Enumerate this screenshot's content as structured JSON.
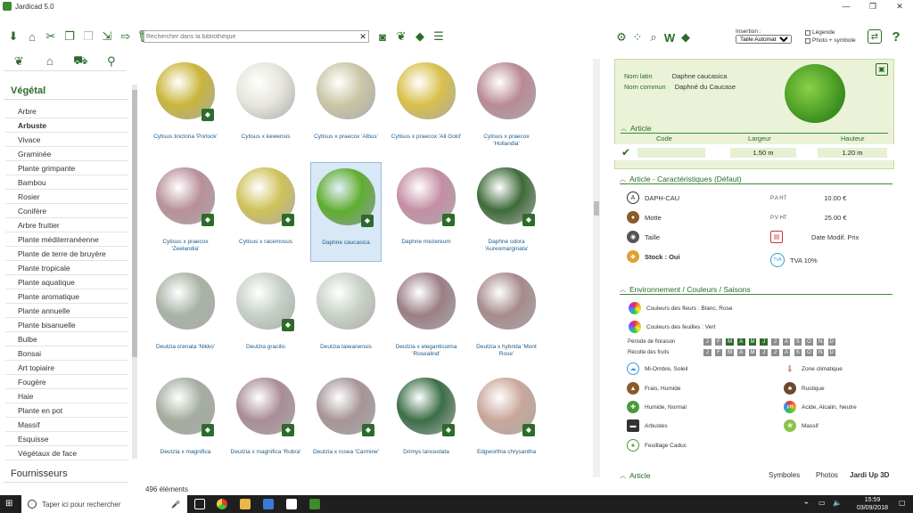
{
  "app": {
    "title": "Jardicad 5.0"
  },
  "window": {
    "min": "—",
    "max": "❐",
    "close": "✕"
  },
  "search": {
    "placeholder": "Rechercher dans la bibliothèque",
    "clear": "✕"
  },
  "sidebar": {
    "section_title": "Végétal",
    "footer_title": "Fournisseurs",
    "items": [
      "Arbre",
      "Arbuste",
      "Vivace",
      "Graminée",
      "Plante grimpante",
      "Bambou",
      "Rosier",
      "Conifère",
      "Arbre fruitier",
      "Plante méditerranéenne",
      "Plante de terre de bruyère",
      "Plante tropicale",
      "Plante aquatique",
      "Plante aromatique",
      "Plante annuelle",
      "Plante bisanuelle",
      "Bulbe",
      "Bonsai",
      "Art topiaire",
      "Fougère",
      "Haie",
      "Plante en pot",
      "Massif",
      "Esquisse",
      "Végétaux de face"
    ],
    "selected_index": 1
  },
  "grid": {
    "items": [
      {
        "label": "Cytisus tinctoria 'Porlock'",
        "color": "#c9b53a",
        "badge": true
      },
      {
        "label": "Cytisus x kewensis",
        "color": "#e6e6dc",
        "badge": false
      },
      {
        "label": "Cytisus x praecox 'Albus'",
        "color": "#c9c6a6",
        "badge": false
      },
      {
        "label": "Cytisus x praecox 'All Gold'",
        "color": "#d8c04a",
        "badge": false
      },
      {
        "label": "Cytisus x praecox 'Hollandia'",
        "color": "#b98a95",
        "badge": false
      },
      {
        "label": "Cytisus x praecox 'Zeelandia'",
        "color": "#b89099",
        "badge": true
      },
      {
        "label": "Cytisus x racemosus",
        "color": "#cfc25a",
        "badge": true
      },
      {
        "label": "Daphne caucasica",
        "color": "#5fae2f",
        "badge": true
      },
      {
        "label": "Daphne mezereum",
        "color": "#c48ea3",
        "badge": true
      },
      {
        "label": "Daphne odora 'Aureomarginata'",
        "color": "#3e6b3a",
        "badge": true
      },
      {
        "label": "Deutzia crenata 'Nikko'",
        "color": "#a9b3a5",
        "badge": false
      },
      {
        "label": "Deutzia gracilis",
        "color": "#c7d0c7",
        "badge": true
      },
      {
        "label": "Deutzia taiwanensis",
        "color": "#c9d2c6",
        "badge": false
      },
      {
        "label": "Deutzia x elegantissima 'Rosealind'",
        "color": "#9b7f86",
        "badge": false
      },
      {
        "label": "Deutzia x hybrida 'Mont Rose'",
        "color": "#a78a8c",
        "badge": false
      },
      {
        "label": "Deutzia x magnifica",
        "color": "#a4ad9f",
        "badge": true
      },
      {
        "label": "Deutzia x magnifica 'Rubra'",
        "color": "#a98d98",
        "badge": true
      },
      {
        "label": "Deutzia x rosea 'Carmine'",
        "color": "#a69597",
        "badge": true
      },
      {
        "label": "Drimys lanceolata",
        "color": "#3c6e48",
        "badge": true
      },
      {
        "label": "Edgworthia chrysantha",
        "color": "#c9a79a",
        "badge": true
      }
    ],
    "selected_index": 7
  },
  "status": {
    "count": "496 éléments"
  },
  "right_toolbar": {
    "insertion_label": "Insertion :",
    "insertion_value": "Taille Automatique",
    "legend": "Légende",
    "photo": "Photo + symbole"
  },
  "detail": {
    "latin_label": "Nom latin",
    "latin_value": "Daphne caucasica",
    "common_label": "Nom commun",
    "common_value": "Daphné du Caucase",
    "article_title": "Article",
    "col_code": "Code",
    "col_largeur": "Largeur",
    "col_hauteur": "Hauteur",
    "code_value": "",
    "largeur_value": "1.50 m",
    "hauteur_value": "1.20 m",
    "carac_title": "Article  - Caractéristiques (Défaut)",
    "ref": "DAPH-CAU",
    "pa_label": "P.A HT",
    "pa_value": "10.00 €",
    "motte": "Motte",
    "pv_label": "P.V HT",
    "pv_value": "25.00 €",
    "taille": "Taille",
    "date_modif": "Date Modif. Prix",
    "stock": "Stock : Oui",
    "tva": "TVA 10%",
    "env_title": "Environnement / Couleurs / Saisons",
    "fleurs": "Couleurs des fleurs : Blanc, Rose",
    "feuilles": "Couleurs des feuilles : Vert",
    "floraison_label": "Période de floraison",
    "recolte_label": "Récolte des fruits",
    "months": [
      "J",
      "F",
      "M",
      "A",
      "M",
      "J",
      "J",
      "A",
      "S",
      "O",
      "N",
      "D"
    ],
    "floraison_on": [
      false,
      false,
      true,
      true,
      true,
      true,
      false,
      false,
      false,
      false,
      false,
      false
    ],
    "recolte_on": [
      false,
      false,
      false,
      false,
      false,
      false,
      false,
      false,
      false,
      false,
      false,
      false
    ],
    "expo": "Mi-Ombre, Soleil",
    "zone": "Zone climatique",
    "temp": "Frais, Humide",
    "rustique": "Rustique",
    "sol": "Humide, Normal",
    "ph": "Acide, Alcalin, Neutre",
    "type": "Arbustes",
    "massif": "Massif",
    "feuillage": "Feuillage Caduc",
    "bottom_article": "Article",
    "tab_symboles": "Symboles",
    "tab_photos": "Photos",
    "tab_jardi": "Jardi Up 3D"
  },
  "taskbar": {
    "search_text": "Taper ici pour rechercher",
    "time": "15:59",
    "date": "03/09/2018"
  }
}
